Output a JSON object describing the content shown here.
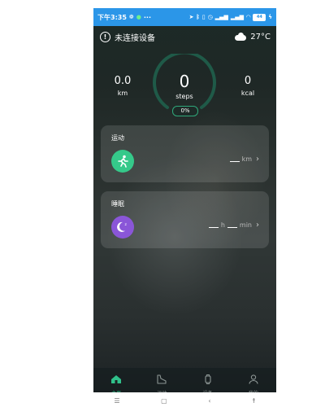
{
  "status_bar": {
    "time": "下午3:35",
    "dots": "···",
    "battery": "44"
  },
  "header": {
    "device_status": "未连接设备",
    "temperature": "27°C"
  },
  "stats": {
    "distance": {
      "value": "0.0",
      "unit": "km"
    },
    "steps": {
      "value": "0",
      "unit": "steps",
      "progress_label": "0%",
      "progress": 0
    },
    "calories": {
      "value": "0",
      "unit": "kcal"
    }
  },
  "cards": {
    "sport": {
      "title": "运动",
      "unit": "km"
    },
    "sleep": {
      "title": "睡眠",
      "unit_hours": "h",
      "unit_minutes": "min"
    }
  },
  "tabs": [
    {
      "label": "主页",
      "icon": "home-icon",
      "active": true
    },
    {
      "label": "运动",
      "icon": "shoe-icon",
      "active": false
    },
    {
      "label": "设备",
      "icon": "watch-icon",
      "active": false
    },
    {
      "label": "我的",
      "icon": "user-icon",
      "active": false
    }
  ],
  "colors": {
    "accent": "#30c08a",
    "status_bar": "#2b96e8",
    "sleep": "#8a56d8"
  },
  "system_nav": {
    "menu": "menu-icon",
    "home": "home-square-icon",
    "back": "back-icon",
    "assist": "accessibility-icon"
  }
}
